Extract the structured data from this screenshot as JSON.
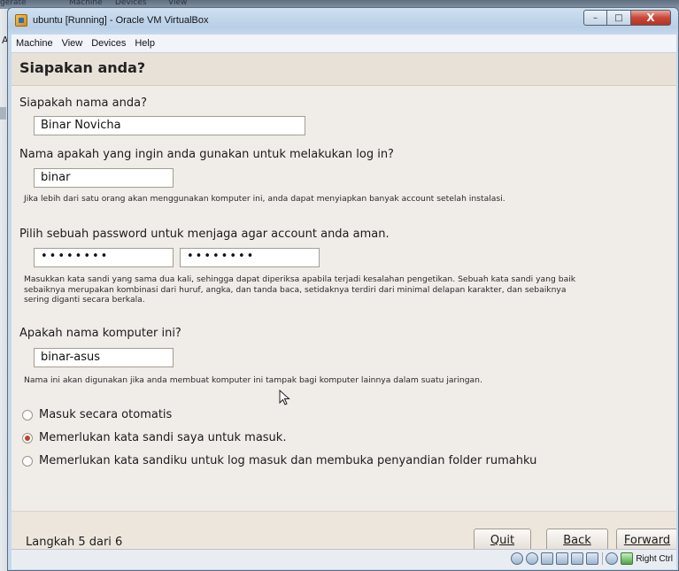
{
  "host": {
    "top_menu": [
      "gerate",
      "Machine",
      "Devices",
      "View"
    ],
    "side_letter": "A"
  },
  "window": {
    "title": "ubuntu [Running] - Oracle VM VirtualBox",
    "controls": {
      "minimize": "–",
      "maximize": "□",
      "close": "X"
    }
  },
  "menu": [
    "Machine",
    "View",
    "Devices",
    "Help"
  ],
  "installer": {
    "heading": "Siapakan anda?",
    "name_question": "Siapakah nama anda?",
    "name_value": "Binar Novicha",
    "login_question": "Nama apakah yang ingin anda gunakan untuk melakukan log in?",
    "login_value": "binar",
    "login_note": "Jika lebih dari satu orang akan menggunakan komputer ini, anda dapat menyiapkan banyak account setelah instalasi.",
    "password_question": "Pilih sebuah password untuk menjaga agar account anda aman.",
    "password_value": "••••••••",
    "password_confirm_value": "••••••••",
    "password_note": "Masukkan kata sandi yang sama dua kali, sehingga dapat diperiksa apabila terjadi kesalahan pengetikan. Sebuah kata sandi yang baik sebaiknya merupakan kombinasi dari huruf, angka, dan tanda baca, setidaknya terdiri dari minimal delapan karakter, dan sebaiknya sering diganti secara berkala.",
    "computer_question": "Apakah nama komputer ini?",
    "computer_value": "binar-asus",
    "computer_note": "Nama ini akan digunakan jika anda membuat komputer ini tampak bagi komputer lainnya dalam suatu jaringan.",
    "login_options": [
      {
        "label": "Masuk secara otomatis",
        "checked": false
      },
      {
        "label": "Memerlukan kata sandi saya untuk masuk.",
        "checked": true
      },
      {
        "label": "Memerlukan kata sandiku untuk log masuk dan membuka penyandian folder rumahku",
        "checked": false
      }
    ],
    "step_text": "Langkah 5 dari 6",
    "buttons": {
      "quit": "Quit",
      "back": "Back",
      "forward": "Forward"
    }
  },
  "statusbar": {
    "icons": [
      "hard-disk-icon",
      "cd-icon",
      "usb-icon",
      "network-icon",
      "shared-folder-icon",
      "display-icon",
      "mouse-integration-icon",
      "capture-icon"
    ],
    "host_key": "Right Ctrl"
  },
  "colors": {
    "radio_accent": "#b9452a",
    "header_bg": "#e8e1d8",
    "content_bg": "#f0ece8"
  }
}
